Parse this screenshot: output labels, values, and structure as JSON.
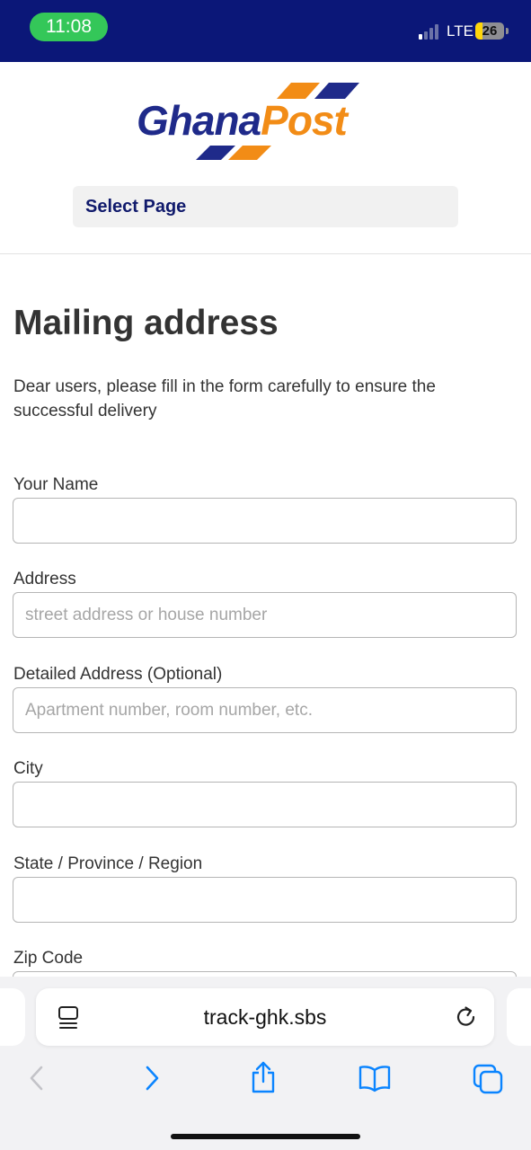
{
  "status_bar": {
    "time": "11:08",
    "network": "LTE",
    "battery": "26",
    "battery_level_percent": 26,
    "background_color": "#0b1778",
    "time_pill_color": "#34c759"
  },
  "header": {
    "logo_text_part1": "Ghana",
    "logo_text_part2": "Post",
    "logo_colors": {
      "primary": "#1f2a8a",
      "accent": "#f28c16"
    },
    "select_page_label": "Select Page"
  },
  "main": {
    "title": "Mailing address",
    "intro": "Dear users, please fill in the form carefully to ensure the successful delivery",
    "fields": [
      {
        "label": "Your Name",
        "value": "",
        "placeholder": ""
      },
      {
        "label": "Address",
        "value": "",
        "placeholder": "street address or house number"
      },
      {
        "label": "Detailed Address (Optional)",
        "value": "",
        "placeholder": "Apartment number, room number, etc."
      },
      {
        "label": "City",
        "value": "",
        "placeholder": ""
      },
      {
        "label": "State / Province / Region",
        "value": "",
        "placeholder": ""
      },
      {
        "label": "Zip Code",
        "value": "",
        "placeholder": ""
      }
    ]
  },
  "browser": {
    "url": "track-ghk.sbs",
    "icons": [
      "reader-icon",
      "reload-icon",
      "back-icon",
      "forward-icon",
      "share-icon",
      "bookmarks-icon",
      "tabs-icon"
    ],
    "accent_color": "#0a84ff"
  }
}
